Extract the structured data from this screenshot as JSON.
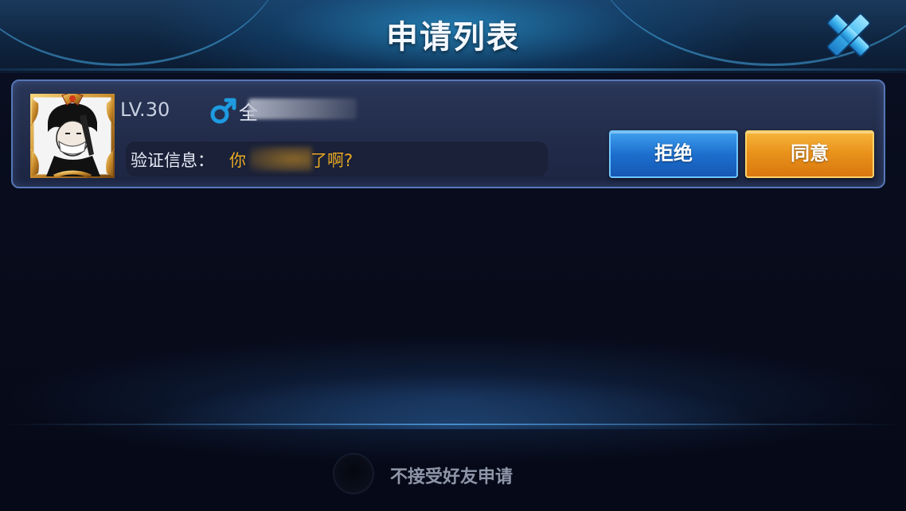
{
  "header": {
    "title": "申请列表"
  },
  "request": {
    "level": "LV.30",
    "gender": "male-icon",
    "name_visible": "全",
    "verify_label": "验证信息：",
    "message_start": "你",
    "message_end": "了啊?",
    "reject_label": "拒绝",
    "accept_label": "同意"
  },
  "footer": {
    "toggle_label": "不接受好友申请",
    "toggle_on": false
  },
  "colors": {
    "accent_orange": "#e8901a",
    "accent_blue": "#1d6fce",
    "message_text": "#e8a820",
    "gender_blue": "#1e9be0"
  }
}
